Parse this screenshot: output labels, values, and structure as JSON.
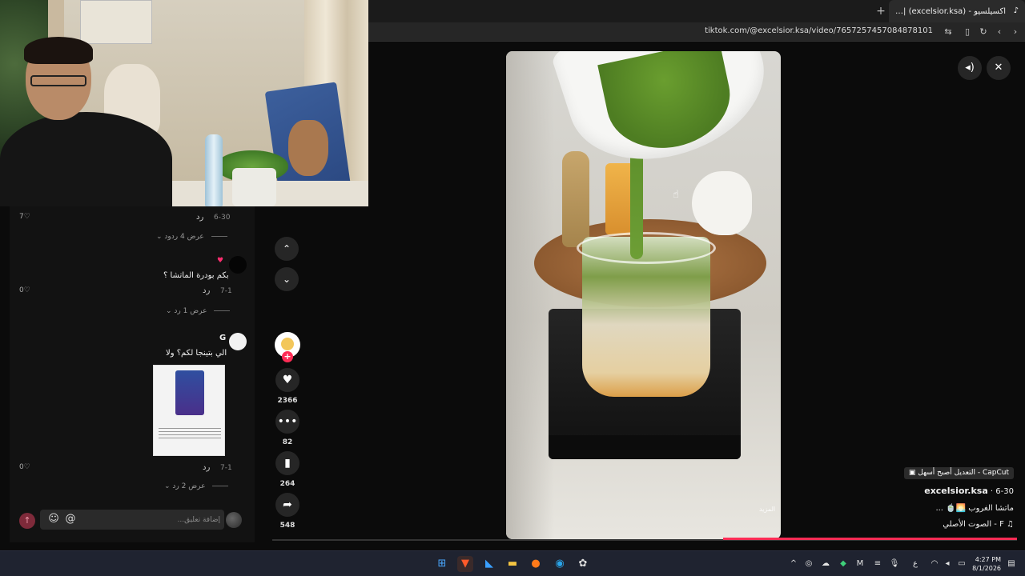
{
  "browser": {
    "tab_title": "اكسيلسيو - TikTok | (excelsior.ksa)",
    "url": "tiktok.com/@excelsior.ksa/video/7657257457084878101"
  },
  "comments": [
    {
      "date": "6-30",
      "reply_label": "رد",
      "likes": "7",
      "view_replies": "عرض 4 ردود"
    },
    {
      "text": "بكم بودرة الماتشا ؟",
      "date": "7-1",
      "reply_label": "رد",
      "likes": "0",
      "view_replies": "عرض 1 رد"
    },
    {
      "author": "G",
      "text": "الي بتينجا لكم؟ ولا",
      "date": "7-1",
      "reply_label": "رد",
      "likes": "0",
      "view_replies": "عرض 2 رد"
    }
  ],
  "comment_input": {
    "placeholder": "إضافة تعليق..."
  },
  "actions": {
    "likes": "2366",
    "comments": "82",
    "saves": "264",
    "shares": "548"
  },
  "video": {
    "watermark": "المزيد",
    "capcut_label": "CapCut - التعديل أصبح أسهل",
    "author": "excelsior.ksa",
    "date": "6-30",
    "caption": "ماتشا الغروب 🌅🍵 ...",
    "sound": "F - الصوت الأصلي"
  },
  "taskbar": {
    "time": "4:27 PM",
    "date": "8/1/2026",
    "lang": "ع"
  },
  "colors": {
    "accent": "#fe2c55",
    "taskbar": "#1f2330"
  }
}
